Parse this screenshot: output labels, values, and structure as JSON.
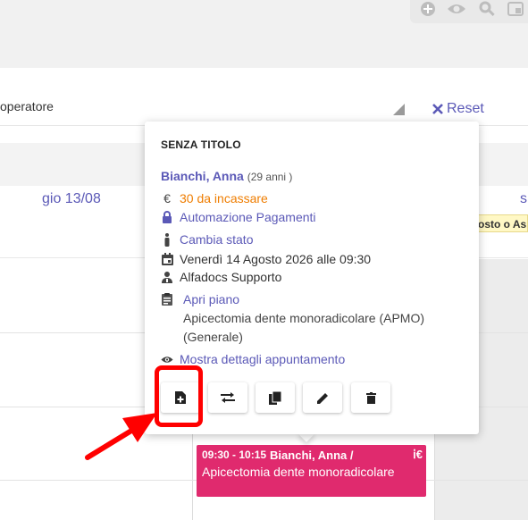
{
  "toolbar": {
    "icons": [
      "add-circle-icon",
      "eye-icon",
      "search-icon",
      "window-icon"
    ]
  },
  "filters": {
    "operator_label": "operatore",
    "reset_label": "Reset"
  },
  "calendar": {
    "day_label": "gio 13/08",
    "next_day_label": "s",
    "tag_text": "osto o As"
  },
  "appointment": {
    "time": "09:30 - 10:15",
    "name": "Bianchi, Anna /",
    "procedure": "Apicectomia dente monoradicolare",
    "status_icons": "ⅰ€"
  },
  "popover": {
    "title": "SENZA TITOLO",
    "patient_name": "Bianchi, Anna",
    "patient_age": "(29 anni )",
    "amount_text": "30 da incassare",
    "automation": "Automazione Pagamenti",
    "change_state": "Cambia stato",
    "datetime": "Venerdì 14 Agosto 2026 alle 09:30",
    "operator": "Alfadocs Supporto",
    "plan_link": "Apri piano",
    "procedure_line1": "Apicectomia dente monoradicolare (APMO)",
    "procedure_line2": "(Generale)",
    "details_link": "Mostra dettagli appuntamento"
  },
  "colors": {
    "accent": "#5b59b7",
    "appointment": "#e02a6e",
    "warning": "#ef7d00",
    "highlight": "#ff0000"
  }
}
